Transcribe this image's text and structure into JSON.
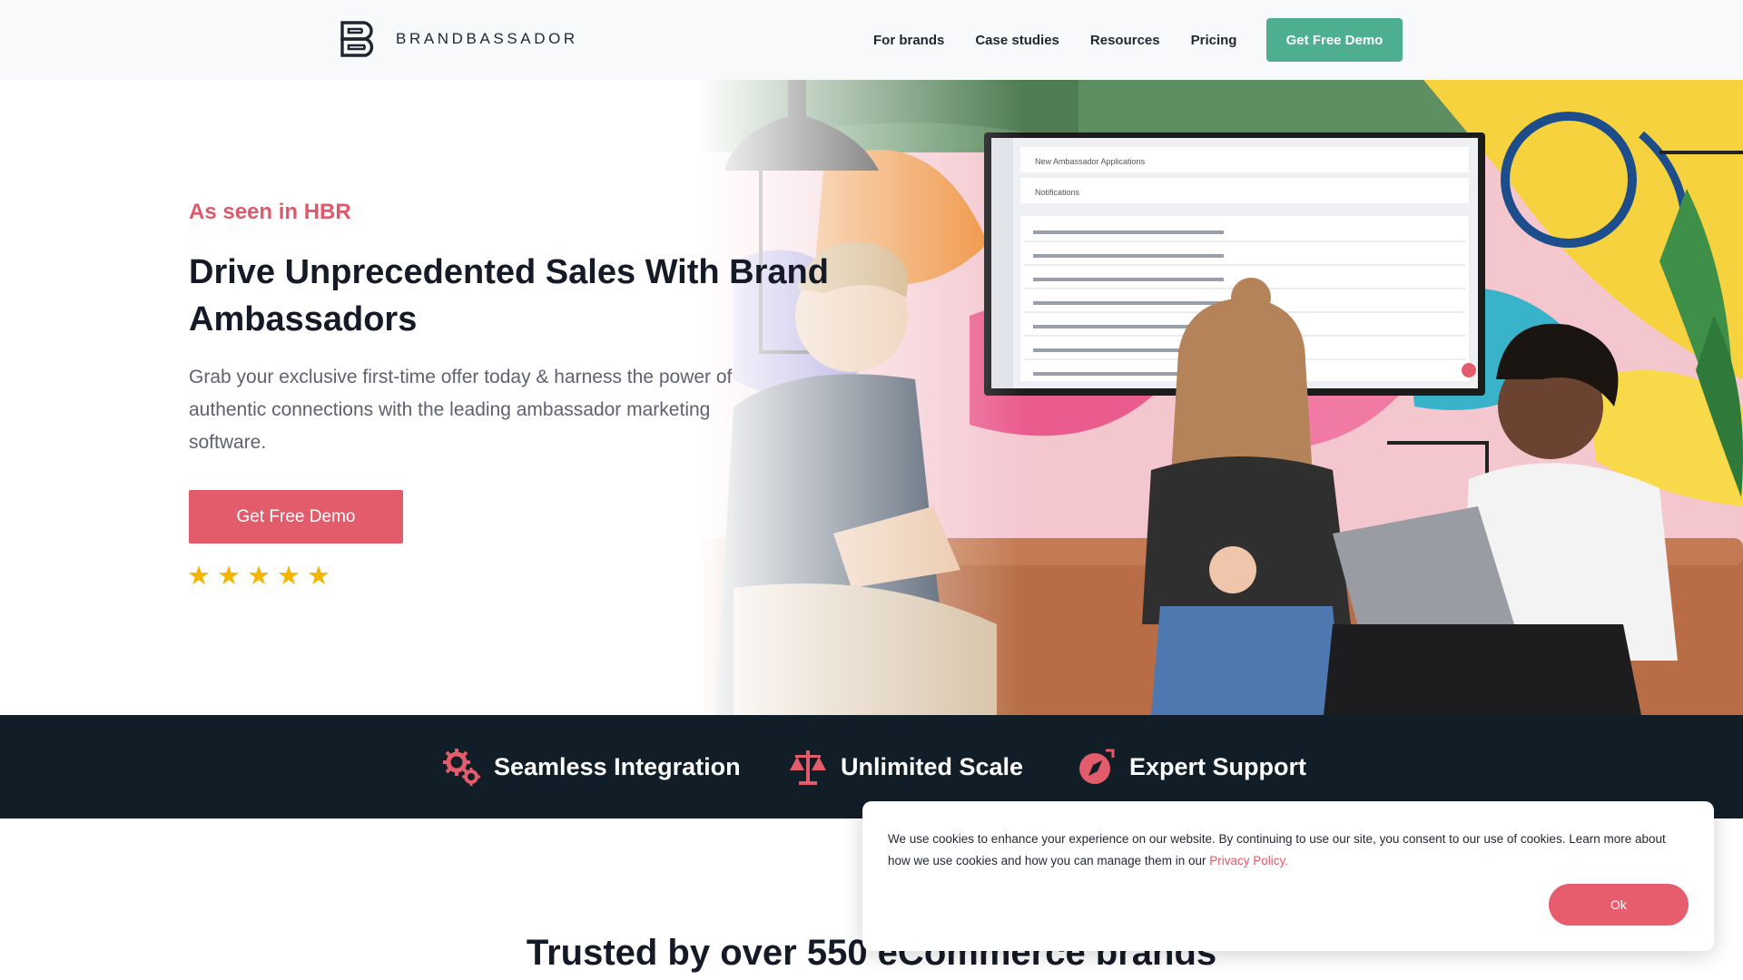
{
  "header": {
    "brand": "BRANDBASSADOR",
    "nav": [
      "For brands",
      "Case studies",
      "Resources",
      "Pricing"
    ],
    "cta": "Get Free Demo"
  },
  "hero": {
    "kicker": "As seen in HBR",
    "title": "Drive Unprecedented Sales With Brand Ambassadors",
    "subtitle": "Grab your exclusive first-time offer today & harness the power of authentic connections with the leading ambassador marketing software.",
    "cta": "Get Free Demo",
    "rating": 5,
    "star_glyph": "★",
    "screen": {
      "applications_label": "New Ambassador Applications",
      "notifications_label": "Notifications"
    }
  },
  "features": [
    {
      "label": "Seamless Integration",
      "icon": "gears-icon"
    },
    {
      "label": "Unlimited Scale",
      "icon": "scale-icon"
    },
    {
      "label": "Expert Support",
      "icon": "compass-icon"
    }
  ],
  "trusted": {
    "heading": "Trusted by over 550 eCommerce brands"
  },
  "cookie": {
    "text": "We use cookies to enhance your experience on our website. By continuing to use our site, you consent to our use of cookies. Learn more about how we use cookies and how you can manage them in our",
    "link": "Privacy Policy.",
    "button": "Ok"
  },
  "colors": {
    "accent": "#e25c6c",
    "green": "#4daf8f",
    "dark_band": "#111d27",
    "star": "#f5b400"
  }
}
